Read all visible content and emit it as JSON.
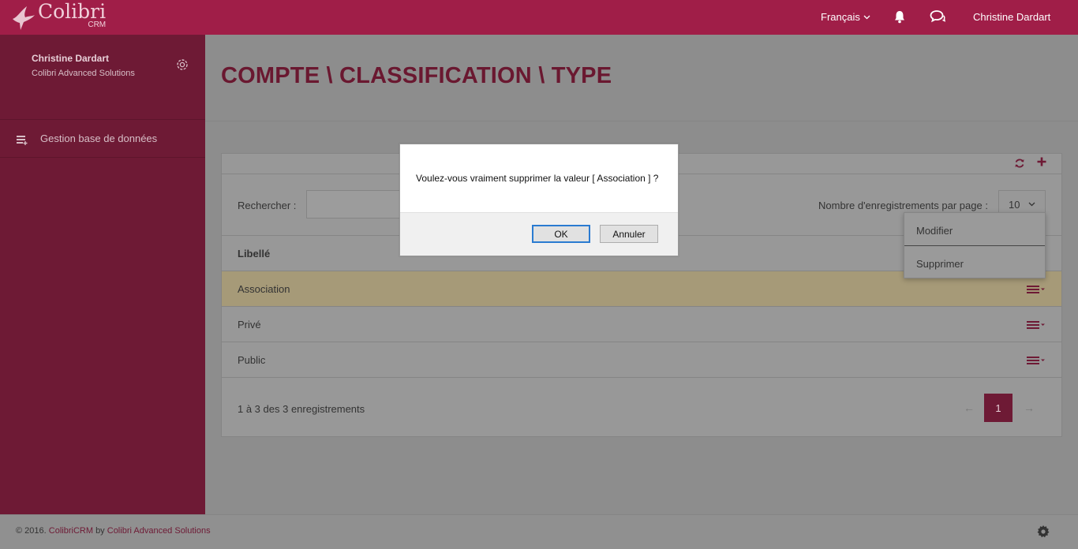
{
  "app": {
    "logo_name": "Colibri",
    "logo_sub": "CRM"
  },
  "topbar": {
    "language": "Français",
    "user": "Christine Dardart",
    "icons": [
      "bell-icon",
      "chat-icon",
      "chevron-down-icon"
    ]
  },
  "sidebar": {
    "profile_name": "Christine Dardart",
    "profile_org": "Colibri Advanced Solutions",
    "items": [
      {
        "label": "Gestion base de données",
        "icon": "database-icon"
      }
    ]
  },
  "main": {
    "title": "COMPTE \\ CLASSIFICATION \\ TYPE",
    "search_label": "Rechercher :",
    "search_value": "",
    "per_page_label": "Nombre d'enregistrements par page :",
    "per_page_value": "10",
    "column_header": "Libellé",
    "rows": [
      {
        "label": "Association",
        "selected": true
      },
      {
        "label": "Privé",
        "selected": false
      },
      {
        "label": "Public",
        "selected": false
      }
    ],
    "count_text": "1 à 3 des 3 enregistrements",
    "pagination": {
      "prev": "←",
      "current": "1",
      "next": "→"
    }
  },
  "context_menu": {
    "items": [
      "Modifier",
      "Supprimer"
    ]
  },
  "footer": {
    "copyright": "© 2016.",
    "product": "ColibriCRM",
    "by": "by",
    "company": "Colibri Advanced Solutions"
  },
  "dialog": {
    "message": "Voulez-vous vraiment supprimer la valeur [ Association ] ?",
    "ok_label": "OK",
    "cancel_label": "Annuler"
  },
  "colors": {
    "brand": "#a01e48",
    "sidebar": "#6e1a35",
    "dialog_focus": "#2a7bd1"
  }
}
